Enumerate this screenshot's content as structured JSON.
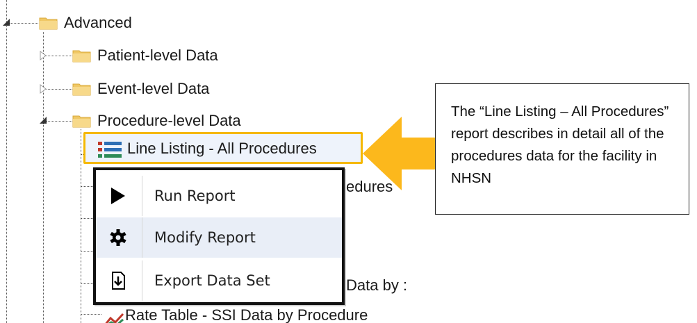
{
  "tree": {
    "root_folder": "Advanced",
    "children": [
      {
        "label": "Patient-level Data"
      },
      {
        "label": "Event-level Data"
      },
      {
        "label": "Procedure-level Data"
      }
    ],
    "selected_item": {
      "label": "Line Listing - All Procedures",
      "icon": "line-listing-icon"
    },
    "partial_rows": [
      {
        "text": "edures"
      },
      {
        "text": "Data by :"
      },
      {
        "text": "Rate Table - SSI Data by Procedure"
      }
    ]
  },
  "context_menu": {
    "items": [
      {
        "label": "Run Report",
        "icon": "play-icon"
      },
      {
        "label": "Modify Report",
        "icon": "gear-icon"
      },
      {
        "label": "Export Data Set",
        "icon": "export-icon"
      }
    ]
  },
  "callout": {
    "text": "The “Line Listing – All Procedures” report describes in detail all of the procedures data for the facility in NHSN"
  },
  "colors": {
    "highlight": "#f5b800",
    "arrow": "#fcb81c",
    "folder": "#f0c866",
    "menu_hover": "#e9eef7"
  }
}
